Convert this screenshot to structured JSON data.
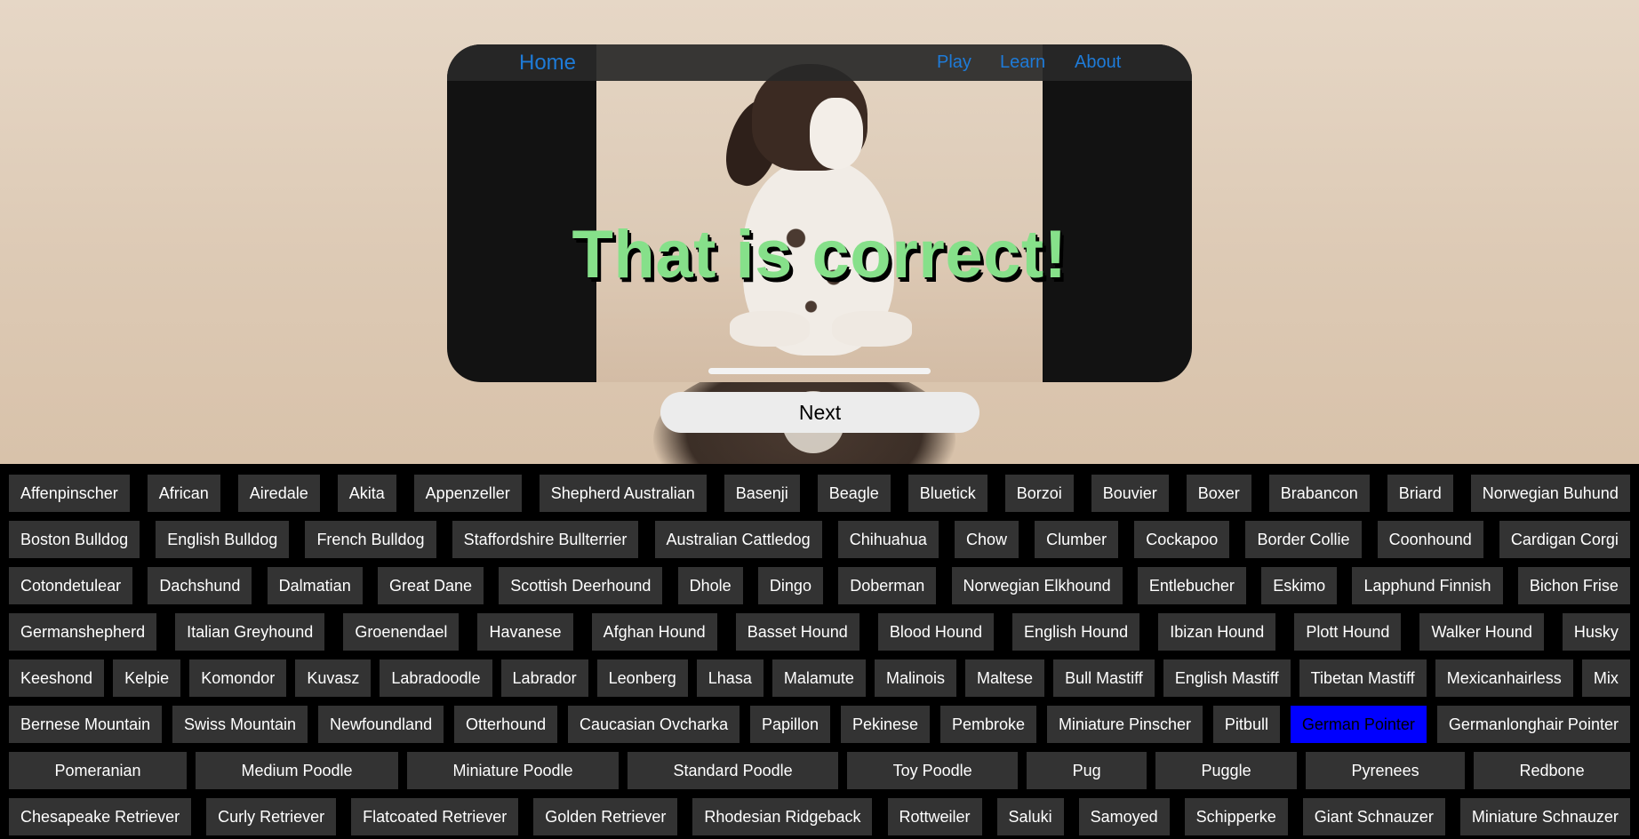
{
  "nav": {
    "home": "Home",
    "play": "Play",
    "learn": "Learn",
    "about": "About",
    "link_color": "#1e7bd8"
  },
  "game": {
    "message": "That is correct!",
    "message_color": "#86e08a",
    "next_label": "Next",
    "selected_breed": "German Pointer",
    "selected_color": "#0000ff"
  },
  "breeds": {
    "row1": [
      "Affenpinscher",
      "African",
      "Airedale",
      "Akita",
      "Appenzeller",
      "Shepherd Australian",
      "Basenji",
      "Beagle",
      "Bluetick",
      "Borzoi",
      "Bouvier",
      "Boxer",
      "Brabancon",
      "Briard",
      "Norwegian Buhund"
    ],
    "row2": [
      "Boston Bulldog",
      "English Bulldog",
      "French Bulldog",
      "Staffordshire Bullterrier",
      "Australian Cattledog",
      "Chihuahua",
      "Chow",
      "Clumber",
      "Cockapoo",
      "Border Collie",
      "Coonhound",
      "Cardigan Corgi"
    ],
    "row3": [
      "Cotondetulear",
      "Dachshund",
      "Dalmatian",
      "Great Dane",
      "Scottish Deerhound",
      "Dhole",
      "Dingo",
      "Doberman",
      "Norwegian Elkhound",
      "Entlebucher",
      "Eskimo",
      "Lapphund Finnish",
      "Bichon Frise"
    ],
    "row4": [
      "Germanshepherd",
      "Italian Greyhound",
      "Groenendael",
      "Havanese",
      "Afghan Hound",
      "Basset Hound",
      "Blood Hound",
      "English Hound",
      "Ibizan Hound",
      "Plott Hound",
      "Walker Hound",
      "Husky"
    ],
    "row5": [
      "Keeshond",
      "Kelpie",
      "Komondor",
      "Kuvasz",
      "Labradoodle",
      "Labrador",
      "Leonberg",
      "Lhasa",
      "Malamute",
      "Malinois",
      "Maltese",
      "Bull Mastiff",
      "English Mastiff",
      "Tibetan Mastiff",
      "Mexicanhairless",
      "Mix"
    ],
    "row6": [
      "Bernese Mountain",
      "Swiss Mountain",
      "Newfoundland",
      "Otterhound",
      "Caucasian Ovcharka",
      "Papillon",
      "Pekinese",
      "Pembroke",
      "Miniature Pinscher",
      "Pitbull",
      "German Pointer",
      "Germanlonghair Pointer"
    ],
    "row7": [
      "Pomeranian",
      "Medium Poodle",
      "Miniature Poodle",
      "Standard Poodle",
      "Toy Poodle",
      "Pug",
      "Puggle",
      "Pyrenees",
      "Redbone"
    ],
    "row8": [
      "Chesapeake Retriever",
      "Curly Retriever",
      "Flatcoated Retriever",
      "Golden Retriever",
      "Rhodesian Ridgeback",
      "Rottweiler",
      "Saluki",
      "Samoyed",
      "Schipperke",
      "Giant Schnauzer",
      "Miniature Schnauzer"
    ]
  }
}
